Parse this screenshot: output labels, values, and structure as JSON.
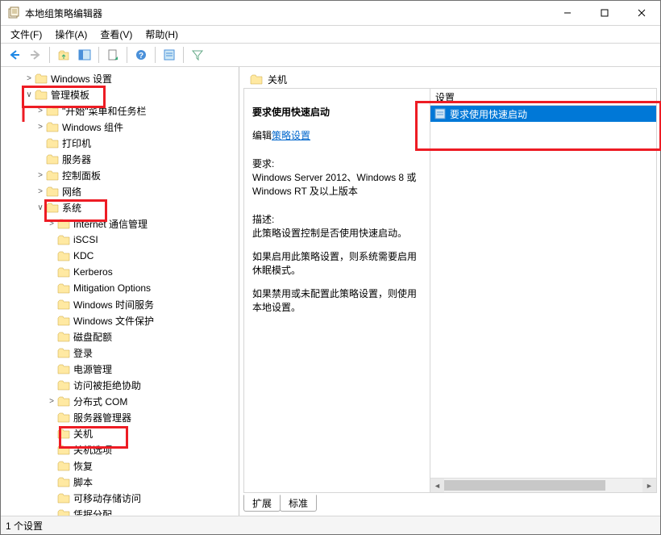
{
  "window": {
    "title": "本地组策略编辑器"
  },
  "menu": {
    "file": "文件(F)",
    "action": "操作(A)",
    "view": "查看(V)",
    "help": "帮助(H)"
  },
  "tree": {
    "items": [
      {
        "lvl": 1,
        "exp": ">",
        "label": "Windows 设置"
      },
      {
        "lvl": 1,
        "exp": "∨",
        "label": "管理模板"
      },
      {
        "lvl": 2,
        "exp": ">",
        "label": "\"开始\"菜单和任务栏"
      },
      {
        "lvl": 2,
        "exp": ">",
        "label": "Windows 组件"
      },
      {
        "lvl": 2,
        "exp": "",
        "label": "打印机"
      },
      {
        "lvl": 2,
        "exp": "",
        "label": "服务器"
      },
      {
        "lvl": 2,
        "exp": ">",
        "label": "控制面板"
      },
      {
        "lvl": 2,
        "exp": ">",
        "label": "网络"
      },
      {
        "lvl": 2,
        "exp": "∨",
        "label": "系统"
      },
      {
        "lvl": 3,
        "exp": ">",
        "label": "Internet 通信管理"
      },
      {
        "lvl": 3,
        "exp": "",
        "label": "iSCSI"
      },
      {
        "lvl": 3,
        "exp": "",
        "label": "KDC"
      },
      {
        "lvl": 3,
        "exp": "",
        "label": "Kerberos"
      },
      {
        "lvl": 3,
        "exp": "",
        "label": "Mitigation Options"
      },
      {
        "lvl": 3,
        "exp": "",
        "label": "Windows 时间服务"
      },
      {
        "lvl": 3,
        "exp": "",
        "label": "Windows 文件保护"
      },
      {
        "lvl": 3,
        "exp": "",
        "label": "磁盘配额"
      },
      {
        "lvl": 3,
        "exp": "",
        "label": "登录"
      },
      {
        "lvl": 3,
        "exp": "",
        "label": "电源管理"
      },
      {
        "lvl": 3,
        "exp": "",
        "label": "访问被拒绝协助"
      },
      {
        "lvl": 3,
        "exp": ">",
        "label": "分布式 COM"
      },
      {
        "lvl": 3,
        "exp": "",
        "label": "服务器管理器"
      },
      {
        "lvl": 3,
        "exp": "",
        "label": "关机"
      },
      {
        "lvl": 3,
        "exp": "",
        "label": "关机选项"
      },
      {
        "lvl": 3,
        "exp": "",
        "label": "恢复"
      },
      {
        "lvl": 3,
        "exp": "",
        "label": "脚本"
      },
      {
        "lvl": 3,
        "exp": "",
        "label": "可移动存储访问"
      },
      {
        "lvl": 3,
        "exp": "",
        "label": "凭据分配"
      }
    ]
  },
  "right": {
    "header": "关机",
    "desc_title": "要求使用快速启动",
    "edit_label": "编辑",
    "edit_link": "策略设置",
    "req_label": "要求:",
    "req_text": "Windows Server 2012、Windows 8 或 Windows RT 及以上版本",
    "desc_label": "描述:",
    "desc_text1": "此策略设置控制是否使用快速启动。",
    "desc_text2": "如果启用此策略设置，则系统需要启用休眠模式。",
    "desc_text3": "如果禁用或未配置此策略设置，则使用本地设置。",
    "col_header": "设置",
    "row0": "要求使用快速启动"
  },
  "tabs": {
    "extended": "扩展",
    "standard": "标准"
  },
  "status": {
    "text": "1 个设置"
  }
}
